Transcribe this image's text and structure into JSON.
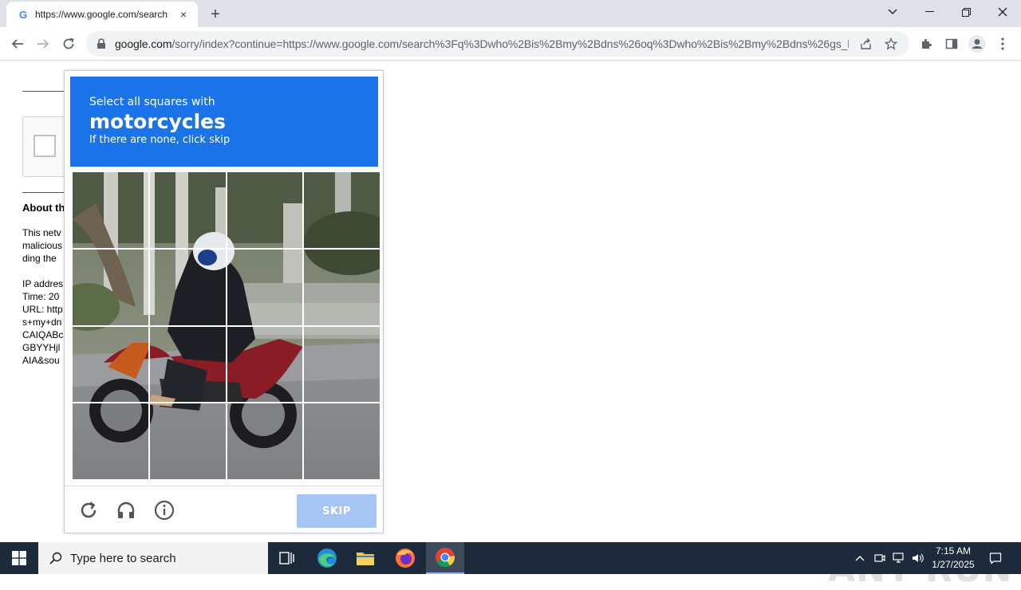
{
  "browser": {
    "tab_title": "https://www.google.com/search",
    "url_host": "google.com",
    "url_path": "/sorry/index?continue=https://www.google.com/search%3Fq%3Dwho%2Bis%2Bmy%2Bdns%26oq%3Dwho%2Bis%2Bmy%2Bdns%26gs_lcr...",
    "new_tab_label": "+",
    "close_tab_label": "×"
  },
  "background_page": {
    "heading": "About th",
    "lines": [
      "This netv",
      "malicious",
      "ding the",
      "IP addres",
      "Time: 20",
      "URL: http",
      "s+my+dn",
      "CAIQABc",
      "GBYYHjl",
      "AIA&sou"
    ]
  },
  "captcha": {
    "prompt_small": "Select all squares with",
    "prompt_target": "motorcycles",
    "prompt_hint": "If there are none, click skip",
    "skip_label": "SKIP",
    "accent_color": "#1a73e8"
  },
  "watermark": "ANY RUN",
  "taskbar": {
    "search_placeholder": "Type here to search",
    "time": "7:15 AM",
    "date": "1/27/2025"
  }
}
